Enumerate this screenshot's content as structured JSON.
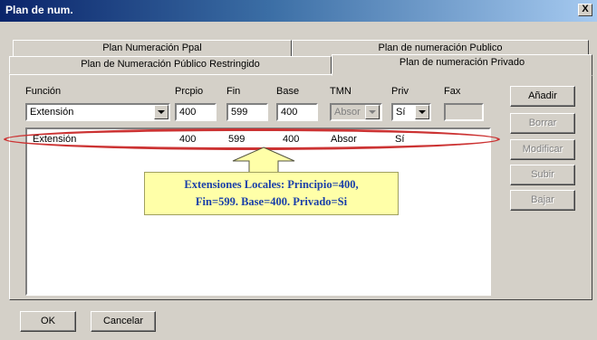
{
  "window": {
    "title": "Plan de num.",
    "close_label": "X"
  },
  "tabs": [
    {
      "label": "Plan Numeración Ppal"
    },
    {
      "label": "Plan de numeración Publico"
    },
    {
      "label": "Plan de Numeración Público Restringido"
    },
    {
      "label": "Plan de numeración Privado",
      "active": true
    }
  ],
  "form": {
    "labels": {
      "funcion": "Función",
      "prcpio": "Prcpio",
      "fin": "Fin",
      "base": "Base",
      "tmn": "TMN",
      "priv": "Priv",
      "fax": "Fax"
    },
    "values": {
      "funcion": "Extensión",
      "prcpio": "400",
      "fin": "599",
      "base": "400",
      "tmn": "Absor",
      "priv": "Sí",
      "fax": ""
    }
  },
  "buttons": {
    "add": "Añadir",
    "delete": "Borrar",
    "modify": "Modificar",
    "up": "Subir",
    "down": "Bajar",
    "ok": "OK",
    "cancel": "Cancelar"
  },
  "list": {
    "rows": [
      {
        "funcion": "Extensión",
        "prcpio": "400",
        "fin": "599",
        "base": "400",
        "tmn": "Absor",
        "priv": "Sí"
      }
    ]
  },
  "annotation": {
    "line1": "Extensiones Locales: Principio=400,",
    "line2": "Fin=599. Base=400. Privado=Si"
  },
  "colors": {
    "titlebar": "#0a246a",
    "highlight_ellipse": "#cc3333",
    "callout_bg": "#ffffa8",
    "callout_text": "#1a3fa8"
  }
}
